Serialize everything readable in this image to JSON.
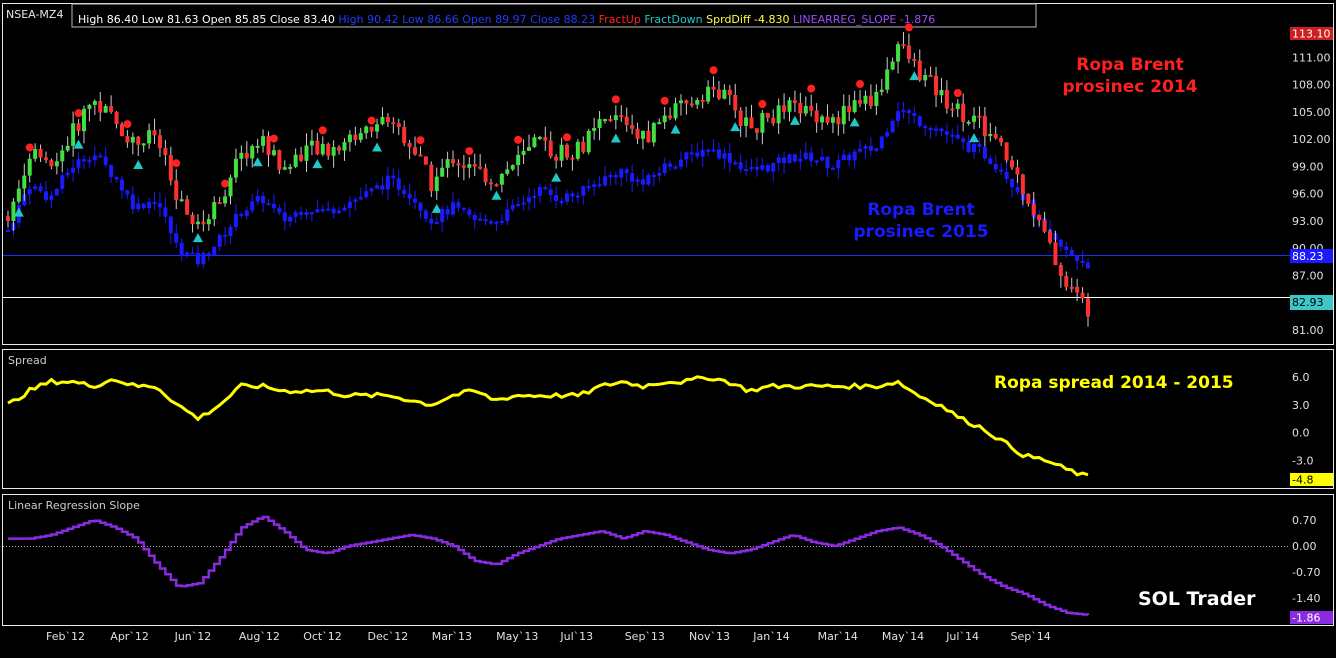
{
  "symbol": "NSEA-MZ4",
  "header": {
    "items": [
      {
        "text": "High",
        "color": "#ffffff"
      },
      {
        "text": "86.40",
        "color": "#ffffff"
      },
      {
        "text": "Low",
        "color": "#ffffff"
      },
      {
        "text": "81.63",
        "color": "#ffffff"
      },
      {
        "text": "Open",
        "color": "#ffffff"
      },
      {
        "text": "85.85",
        "color": "#ffffff"
      },
      {
        "text": "Close",
        "color": "#ffffff"
      },
      {
        "text": "83.40",
        "color": "#ffffff"
      },
      {
        "text": "High",
        "color": "#1f3cff"
      },
      {
        "text": "90.42",
        "color": "#1f3cff"
      },
      {
        "text": "Low",
        "color": "#1f3cff"
      },
      {
        "text": "86.66",
        "color": "#1f3cff"
      },
      {
        "text": "Open",
        "color": "#1f3cff"
      },
      {
        "text": "89.97",
        "color": "#1f3cff"
      },
      {
        "text": "Close",
        "color": "#1f3cff"
      },
      {
        "text": "88.23",
        "color": "#1f3cff"
      },
      {
        "text": "FractUp",
        "color": "#ff2020"
      },
      {
        "text": "FractDown",
        "color": "#20c8c8"
      },
      {
        "text": "SprdDiff",
        "color": "#ffff40"
      },
      {
        "text": "-4.830",
        "color": "#ffff40"
      },
      {
        "text": "LINEARREG_SLOPE",
        "color": "#9a4dff"
      },
      {
        "text": "-1.876",
        "color": "#9a4dff"
      }
    ]
  },
  "annotations": {
    "brent2014_line1": "Ropa Brent",
    "brent2014_line2": "prosinec 2014",
    "brent2015_line1": "Ropa Brent",
    "brent2015_line2": "prosinec 2015",
    "spread_label": "Ropa spread 2014 - 2015",
    "brand": "SOL Trader"
  },
  "panels": {
    "spread_title": "Spread",
    "slope_title": "Linear Regression Slope"
  },
  "price_axis": {
    "ticks": [
      "111.00",
      "108.00",
      "105.00",
      "102.00",
      "99.00",
      "96.00",
      "93.00",
      "90.00",
      "87.00",
      "81.00"
    ],
    "last_2014": "113.10",
    "last_2015": "88.23",
    "last_main": "82.93"
  },
  "spread_axis": {
    "ticks": [
      "6.0",
      "3.0",
      "0.0",
      "-3.0"
    ],
    "last": "-4.8"
  },
  "slope_axis": {
    "ticks": [
      "0.70",
      "0.00",
      "-0.70",
      "-1.40"
    ],
    "last": "-1.86"
  },
  "x_axis": {
    "labels": [
      "Feb`12",
      "Apr`12",
      "Jun`12",
      "Aug`12",
      "Oct`12",
      "Dec`12",
      "Mar`13",
      "May`13",
      "Jul`13",
      "Sep`13",
      "Nov`13",
      "Jan`14",
      "Mar`14",
      "May`14",
      "Jul`14",
      "Sep`14"
    ]
  },
  "colors": {
    "background": "#000000",
    "candle_up": "#40e040",
    "candle_down": "#ff3030",
    "blue_bars": "#1a1aff",
    "fract_up": "#ff2020",
    "fract_down": "#20c8c8",
    "spread_line": "#ffff00",
    "slope_line": "#8a2be2",
    "annotation_red": "#ff2020",
    "annotation_blue": "#1a1aff",
    "annotation_yellow": "#ffff00"
  },
  "chart_data": [
    {
      "type": "line",
      "title": "NSEA-MZ4",
      "series": [
        {
          "name": "Ropa Brent prosinec 2014",
          "values": [
            93.5,
            100.5,
            98.5,
            102.5,
            106.5,
            104.0,
            101.5,
            102.5,
            95.0,
            92.0,
            95.5,
            100.0,
            102.0,
            98.5,
            101.0,
            100.5,
            102.0,
            103.0,
            104.5,
            101.5,
            97.0,
            100.0,
            98.5,
            97.5,
            99.5,
            101.5,
            100.5,
            101.0,
            103.5,
            104.5,
            102.0,
            104.5,
            105.5,
            107.5,
            106.5,
            103.0,
            104.5,
            105.5,
            105.0,
            104.0,
            106.0,
            106.5,
            112.5,
            109.5,
            107.0,
            105.0,
            103.5,
            100.5,
            96.5,
            91.0,
            86.0,
            83.4
          ]
        },
        {
          "name": "Ropa Brent prosinec 2015",
          "values": [
            92.0,
            97.0,
            95.5,
            99.0,
            100.5,
            98.0,
            94.5,
            95.5,
            90.0,
            88.5,
            91.0,
            94.0,
            95.5,
            93.0,
            94.5,
            94.0,
            95.0,
            96.0,
            97.5,
            96.0,
            93.0,
            94.5,
            93.0,
            93.0,
            94.5,
            96.5,
            95.5,
            96.0,
            97.5,
            98.5,
            97.0,
            99.0,
            100.0,
            101.0,
            100.0,
            98.5,
            99.0,
            100.0,
            100.0,
            99.0,
            100.5,
            101.0,
            105.5,
            104.0,
            103.0,
            101.5,
            100.5,
            98.5,
            95.5,
            91.5,
            89.5,
            88.23
          ]
        }
      ],
      "ylim": [
        80,
        114
      ]
    },
    {
      "type": "line",
      "title": "Spread",
      "series": [
        {
          "name": "SprdDiff",
          "values": [
            3.0,
            4.5,
            5.5,
            5.5,
            5.0,
            5.8,
            5.0,
            5.0,
            3.0,
            1.5,
            3.0,
            5.0,
            5.0,
            4.5,
            4.5,
            4.5,
            4.0,
            4.0,
            4.0,
            3.5,
            3.0,
            4.0,
            4.5,
            3.5,
            4.0,
            4.0,
            4.0,
            4.0,
            5.0,
            5.5,
            5.0,
            5.5,
            5.5,
            6.0,
            5.5,
            4.5,
            5.0,
            5.0,
            5.0,
            5.0,
            5.0,
            5.0,
            5.5,
            4.0,
            3.0,
            1.5,
            0.5,
            -1.0,
            -2.5,
            -3.0,
            -4.0,
            -4.8
          ]
        }
      ],
      "ylim": [
        -5,
        7
      ]
    },
    {
      "type": "line",
      "title": "Linear Regression Slope",
      "series": [
        {
          "name": "LINEARREG_SLOPE",
          "values": [
            0.2,
            0.2,
            0.3,
            0.5,
            0.7,
            0.5,
            0.2,
            -0.5,
            -1.1,
            -1.0,
            -0.3,
            0.5,
            0.8,
            0.4,
            -0.1,
            -0.2,
            0.0,
            0.1,
            0.2,
            0.3,
            0.2,
            0.0,
            -0.4,
            -0.5,
            -0.2,
            0.0,
            0.2,
            0.3,
            0.4,
            0.2,
            0.4,
            0.3,
            0.1,
            -0.1,
            -0.2,
            -0.1,
            0.1,
            0.3,
            0.1,
            0.0,
            0.2,
            0.4,
            0.5,
            0.3,
            0.0,
            -0.4,
            -0.8,
            -1.1,
            -1.3,
            -1.6,
            -1.8,
            -1.86
          ]
        }
      ],
      "ylim": [
        -2.0,
        1.1
      ]
    }
  ]
}
